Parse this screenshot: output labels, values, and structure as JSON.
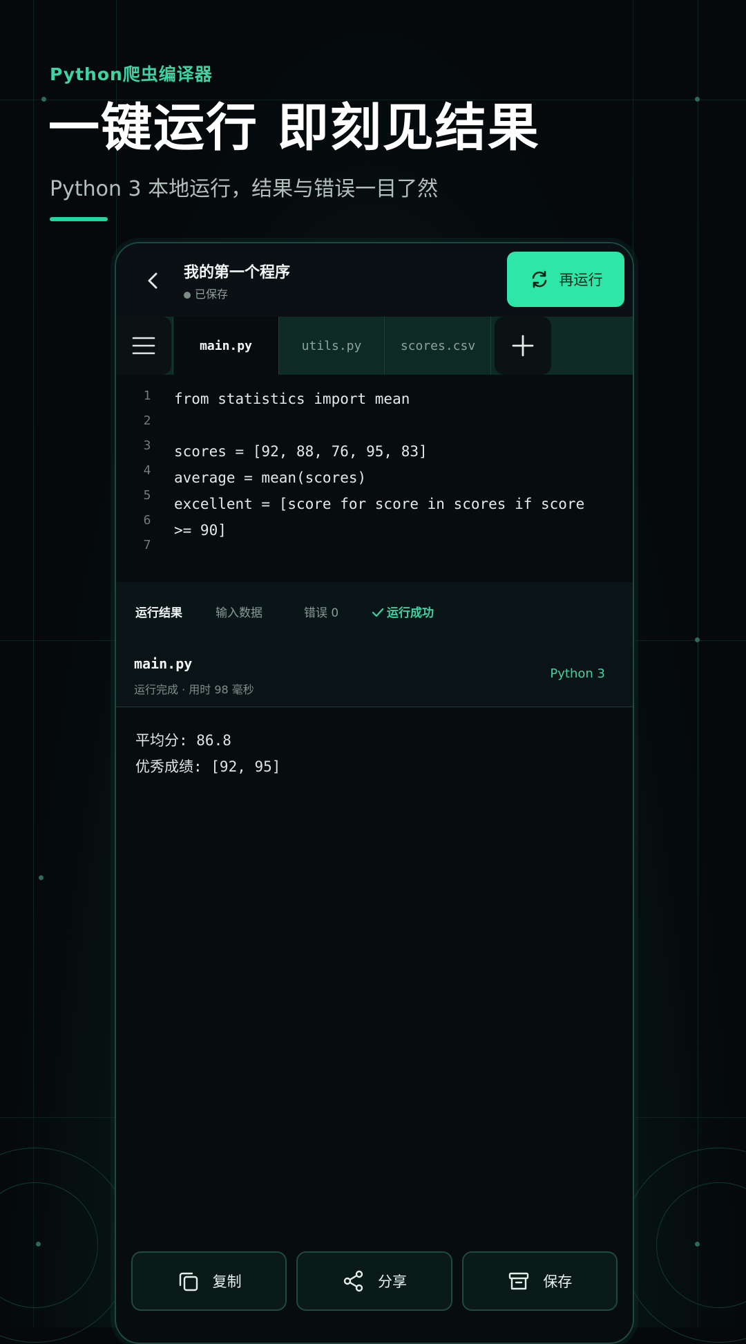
{
  "hero": {
    "eyebrow": "Python爬虫编译器",
    "headline": "一键运行 即刻见结果",
    "subline": "Python 3 本地运行，结果与错误一目了然"
  },
  "topbar": {
    "title": "我的第一个程序",
    "status": "已保存",
    "rerun_label": "再运行"
  },
  "tabs": [
    {
      "label": "main.py",
      "active": true
    },
    {
      "label": "utils.py",
      "active": false
    },
    {
      "label": "scores.csv",
      "active": false
    }
  ],
  "editor": {
    "line_numbers": [
      "1",
      "2",
      "3",
      "4",
      "5",
      "6",
      "7"
    ],
    "code_lines": [
      "from statistics import mean",
      "",
      "scores = [92, 88, 76, 95, 83]",
      "average = mean(scores)",
      "excellent = [score for score in scores if score",
      ">= 90]"
    ]
  },
  "results": {
    "tab_result": "运行结果",
    "tab_input": "输入数据",
    "tab_errors": "错误 0",
    "status": "运行成功",
    "file_name": "main.py",
    "file_meta": "运行完成 · 用时 98 毫秒",
    "runtime": "Python 3",
    "output_lines": [
      "平均分: 86.8",
      "优秀成绩:  [92, 95]"
    ]
  },
  "actions": {
    "copy": "复制",
    "share": "分享",
    "save": "保存"
  },
  "colors": {
    "accent": "#2ee6a8",
    "accent_text": "#3fd3a1",
    "background": "#05090c"
  }
}
